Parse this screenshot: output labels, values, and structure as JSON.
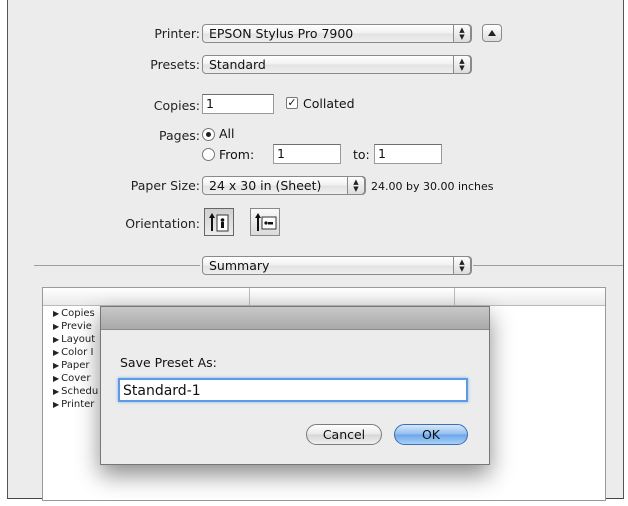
{
  "printer": {
    "label": "Printer:",
    "value": "EPSON Stylus Pro 7900"
  },
  "presets": {
    "label": "Presets:",
    "value": "Standard"
  },
  "copies": {
    "label": "Copies:",
    "value": "1",
    "collated_label": "Collated",
    "collated_checked": true
  },
  "pages": {
    "label": "Pages:",
    "all_label": "All",
    "from_label": "From:",
    "from_value": "1",
    "to_label": "to:",
    "to_value": "1"
  },
  "paper_size": {
    "label": "Paper Size:",
    "value": "24 x 30 in (Sheet)",
    "dimensions": "24.00 by 30.00 inches"
  },
  "orientation": {
    "label": "Orientation:",
    "options": [
      "portrait-orientation-icon",
      "landscape-orientation-icon"
    ]
  },
  "panel_select": {
    "value": "Summary"
  },
  "summary_list": {
    "items": [
      "Copies",
      "Previe",
      "Layout",
      "Color I",
      "Paper",
      "Cover",
      "Schedu",
      "Printer"
    ]
  },
  "save_dialog": {
    "prompt": "Save Preset As:",
    "name_value": "Standard-1",
    "cancel_label": "Cancel",
    "ok_label": "OK"
  },
  "colors": {
    "default_button": "#6aa6ea",
    "focus_ring": "#5b9be6"
  }
}
